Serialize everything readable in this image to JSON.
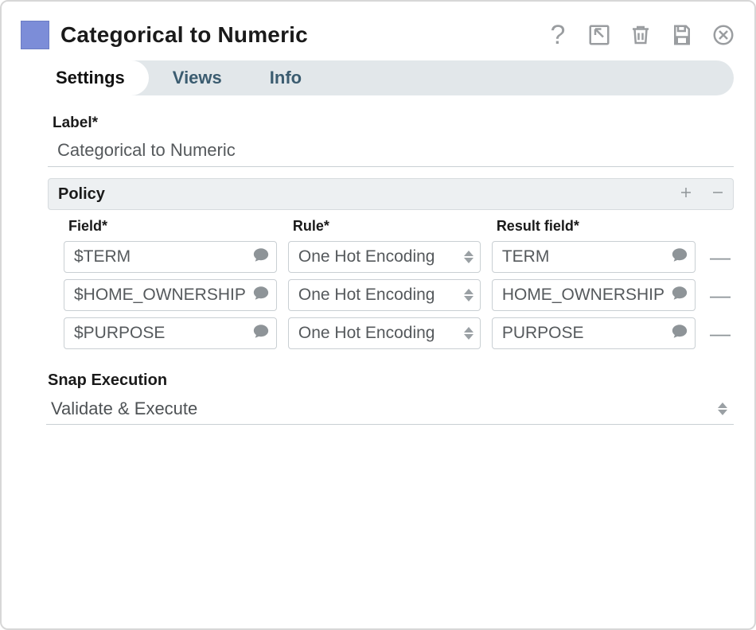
{
  "header": {
    "title": "Categorical to Numeric",
    "swatch_color": "#7c8dd8"
  },
  "tabs": [
    {
      "label": "Settings",
      "active": true
    },
    {
      "label": "Views",
      "active": false
    },
    {
      "label": "Info",
      "active": false
    }
  ],
  "label_field": {
    "label": "Label*",
    "value": "Categorical to Numeric"
  },
  "policy": {
    "section_title": "Policy",
    "columns": {
      "field": "Field*",
      "rule": "Rule*",
      "result": "Result field*"
    },
    "rows": [
      {
        "field": "$TERM",
        "rule": "One Hot Encoding",
        "result": "TERM"
      },
      {
        "field": "$HOME_OWNERSHIP",
        "rule": "One Hot Encoding",
        "result": "HOME_OWNERSHIP"
      },
      {
        "field": "$PURPOSE",
        "rule": "One Hot Encoding",
        "result": "PURPOSE"
      }
    ]
  },
  "snap_execution": {
    "label": "Snap Execution",
    "value": "Validate & Execute"
  }
}
